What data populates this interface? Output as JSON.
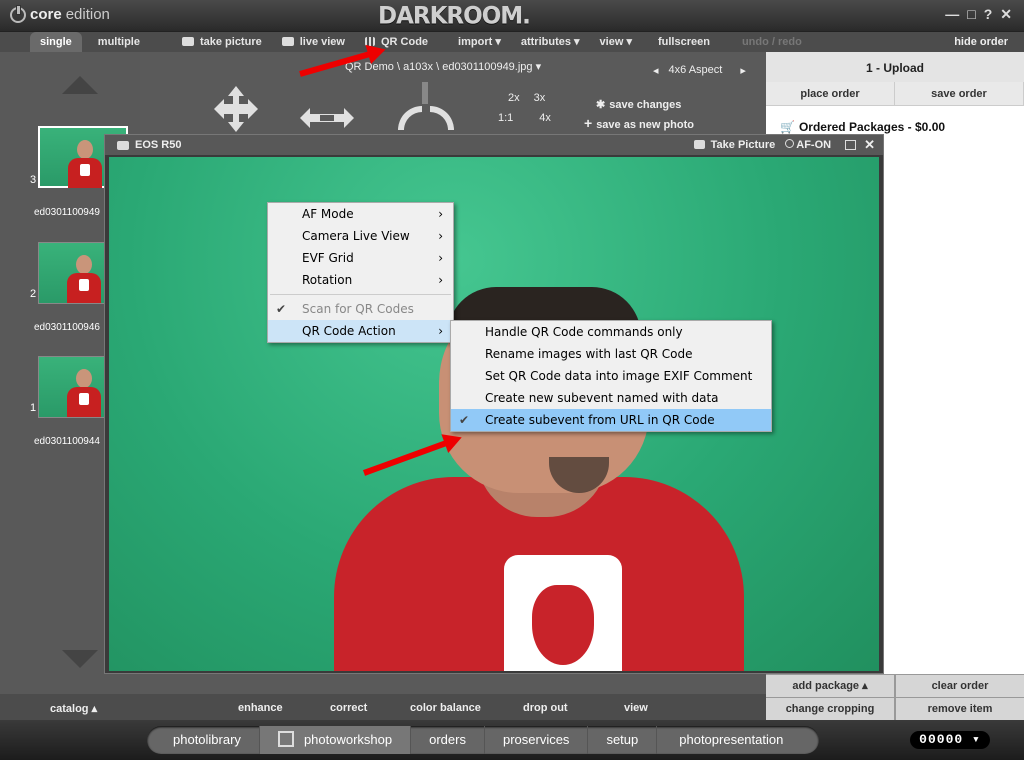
{
  "app": {
    "brand_bold": "core",
    "brand_light": "edition",
    "logo": "DARKROOM.",
    "window_controls": [
      "—",
      "□",
      "?",
      "✕"
    ]
  },
  "menubar": {
    "items": [
      {
        "label": "single",
        "active": true
      },
      {
        "label": "multiple"
      },
      {
        "label": "take picture",
        "icon": "camera-icon"
      },
      {
        "label": "live view",
        "icon": "monitor-icon"
      },
      {
        "label": "QR Code",
        "icon": "qr-icon"
      },
      {
        "label": "import ▾"
      },
      {
        "label": "attributes ▾"
      },
      {
        "label": "view ▾"
      },
      {
        "label": "fullscreen"
      },
      {
        "label": "undo / redo",
        "disabled": true
      }
    ],
    "hide_order": "hide order"
  },
  "filmstrip": {
    "items": [
      {
        "number": "3",
        "name": "ed0301100949",
        "selected": true
      },
      {
        "number": "2",
        "name": "ed0301100946"
      },
      {
        "number": "1",
        "name": "ed0301100944"
      }
    ]
  },
  "toolbar": {
    "filepath": "QR Demo \\ a103x \\ ed0301100949.jpg ▾",
    "aspect_prev": "◂",
    "aspect": "4x6 Aspect",
    "aspect_next": "▸",
    "zoom_2x": "2x",
    "zoom_3x": "3x",
    "zoom_1x": "1:1",
    "zoom_4x": "4x",
    "save_changes": "save changes",
    "save_as_new": "save as new photo"
  },
  "order": {
    "header": "1 - Upload",
    "place_order": "place order",
    "save_order": "save order",
    "packages": "Ordered Packages - $0.00",
    "add_package": "add package ▴",
    "clear_order": "clear order",
    "change_cropping": "change cropping",
    "remove_item": "remove item"
  },
  "camera": {
    "title": "EOS R50",
    "take_picture": "Take Picture",
    "af_on": "AF-ON"
  },
  "context_menu": {
    "items": [
      {
        "label": "AF Mode",
        "submenu": true
      },
      {
        "label": "Camera Live View",
        "submenu": true
      },
      {
        "label": "EVF Grid",
        "submenu": true
      },
      {
        "label": "Rotation",
        "submenu": true
      },
      {
        "label": "Scan for QR Codes",
        "checked": true,
        "disabled": true
      },
      {
        "label": "QR Code Action",
        "submenu": true,
        "highlighted": true
      }
    ]
  },
  "submenu": {
    "items": [
      {
        "label": "Handle QR Code commands only"
      },
      {
        "label": "Rename images with last QR Code"
      },
      {
        "label": "Set QR Code data into image EXIF Comment"
      },
      {
        "label": "Create new subevent named with data"
      },
      {
        "label": "Create subevent from URL in QR Code",
        "checked": true,
        "highlighted": true
      }
    ]
  },
  "bottom_tabs": {
    "catalog": "catalog ▴",
    "enhance": "enhance",
    "correct": "correct",
    "color_balance": "color balance",
    "drop_out": "drop out",
    "view": "view"
  },
  "nav": {
    "items": [
      {
        "label": "photolibrary"
      },
      {
        "label": "photoworkshop",
        "active": true
      },
      {
        "label": "orders"
      },
      {
        "label": "proservices"
      },
      {
        "label": "setup"
      },
      {
        "label": "photopresentation"
      }
    ],
    "counter": "00000 ▾"
  },
  "colors": {
    "accent_red": "#e00000",
    "menu_highlight": "#91c9f7",
    "green_screen": "#2aa874"
  }
}
